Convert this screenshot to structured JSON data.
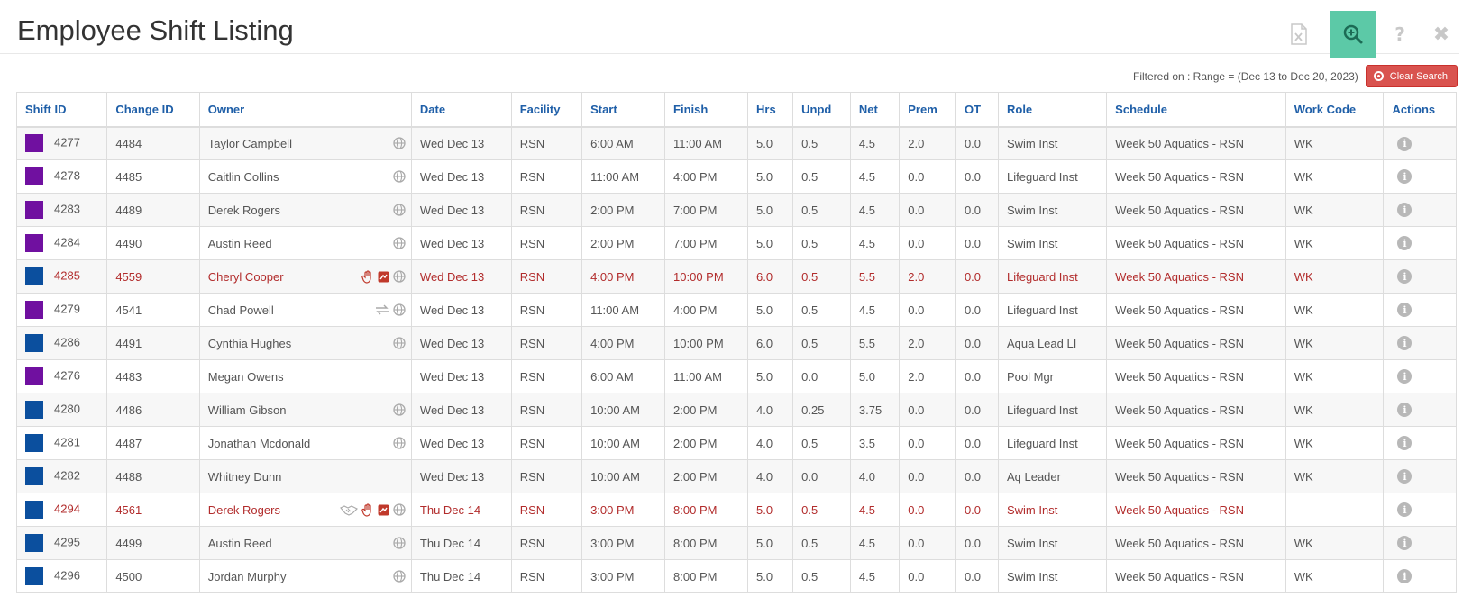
{
  "header": {
    "title": "Employee Shift Listing",
    "toolbar": [
      {
        "name": "excel-export-icon"
      },
      {
        "name": "search-zoom-icon",
        "active": true
      },
      {
        "name": "help-icon"
      },
      {
        "name": "close-icon"
      }
    ]
  },
  "filter": {
    "text": "Filtered on : Range = (Dec 13 to Dec 20, 2023)",
    "clear_label": "Clear Search"
  },
  "table": {
    "columns": [
      "Shift ID",
      "Change ID",
      "Owner",
      "Date",
      "Facility",
      "Start",
      "Finish",
      "Hrs",
      "Unpd",
      "Net",
      "Prem",
      "OT",
      "Role",
      "Schedule",
      "Work Code",
      "Actions"
    ],
    "rows": [
      {
        "color": "purple",
        "shift_id": "4277",
        "change_id": "4484",
        "owner": "Taylor Campbell",
        "icons": [
          "globe"
        ],
        "date": "Wed Dec 13",
        "facility": "RSN",
        "start": "6:00 AM",
        "finish": "11:00 AM",
        "hrs": "5.0",
        "unpd": "0.5",
        "net": "4.5",
        "prem": "2.0",
        "ot": "0.0",
        "role": "Swim Inst",
        "schedule": "Week 50 Aquatics - RSN",
        "work_code": "WK",
        "changed": false
      },
      {
        "color": "purple",
        "shift_id": "4278",
        "change_id": "4485",
        "owner": "Caitlin Collins",
        "icons": [
          "globe"
        ],
        "date": "Wed Dec 13",
        "facility": "RSN",
        "start": "11:00 AM",
        "finish": "4:00 PM",
        "hrs": "5.0",
        "unpd": "0.5",
        "net": "4.5",
        "prem": "0.0",
        "ot": "0.0",
        "role": "Lifeguard Inst",
        "schedule": "Week 50 Aquatics - RSN",
        "work_code": "WK",
        "changed": false
      },
      {
        "color": "purple",
        "shift_id": "4283",
        "change_id": "4489",
        "owner": "Derek Rogers",
        "icons": [
          "globe"
        ],
        "date": "Wed Dec 13",
        "facility": "RSN",
        "start": "2:00 PM",
        "finish": "7:00 PM",
        "hrs": "5.0",
        "unpd": "0.5",
        "net": "4.5",
        "prem": "0.0",
        "ot": "0.0",
        "role": "Swim Inst",
        "schedule": "Week 50 Aquatics - RSN",
        "work_code": "WK",
        "changed": false
      },
      {
        "color": "purple",
        "shift_id": "4284",
        "change_id": "4490",
        "owner": "Austin Reed",
        "icons": [
          "globe"
        ],
        "date": "Wed Dec 13",
        "facility": "RSN",
        "start": "2:00 PM",
        "finish": "7:00 PM",
        "hrs": "5.0",
        "unpd": "0.5",
        "net": "4.5",
        "prem": "0.0",
        "ot": "0.0",
        "role": "Swim Inst",
        "schedule": "Week 50 Aquatics - RSN",
        "work_code": "WK",
        "changed": false
      },
      {
        "color": "blue",
        "shift_id": "4285",
        "change_id": "4559",
        "owner": "Cheryl Cooper",
        "icons": [
          "hand",
          "red-square",
          "globe"
        ],
        "date": "Wed Dec 13",
        "facility": "RSN",
        "start": "4:00 PM",
        "finish": "10:00 PM",
        "hrs": "6.0",
        "unpd": "0.5",
        "net": "5.5",
        "prem": "2.0",
        "ot": "0.0",
        "role": "Lifeguard Inst",
        "schedule": "Week 50 Aquatics - RSN",
        "work_code": "WK",
        "changed": true
      },
      {
        "color": "purple",
        "shift_id": "4279",
        "change_id": "4541",
        "owner": "Chad Powell",
        "icons": [
          "swap",
          "globe"
        ],
        "date": "Wed Dec 13",
        "facility": "RSN",
        "start": "11:00 AM",
        "finish": "4:00 PM",
        "hrs": "5.0",
        "unpd": "0.5",
        "net": "4.5",
        "prem": "0.0",
        "ot": "0.0",
        "role": "Lifeguard Inst",
        "schedule": "Week 50 Aquatics - RSN",
        "work_code": "WK",
        "changed": false
      },
      {
        "color": "blue",
        "shift_id": "4286",
        "change_id": "4491",
        "owner": "Cynthia Hughes",
        "icons": [
          "globe"
        ],
        "date": "Wed Dec 13",
        "facility": "RSN",
        "start": "4:00 PM",
        "finish": "10:00 PM",
        "hrs": "6.0",
        "unpd": "0.5",
        "net": "5.5",
        "prem": "2.0",
        "ot": "0.0",
        "role": "Aqua Lead LI",
        "schedule": "Week 50 Aquatics - RSN",
        "work_code": "WK",
        "changed": false
      },
      {
        "color": "purple",
        "shift_id": "4276",
        "change_id": "4483",
        "owner": "Megan Owens",
        "icons": [],
        "date": "Wed Dec 13",
        "facility": "RSN",
        "start": "6:00 AM",
        "finish": "11:00 AM",
        "hrs": "5.0",
        "unpd": "0.0",
        "net": "5.0",
        "prem": "2.0",
        "ot": "0.0",
        "role": "Pool Mgr",
        "schedule": "Week 50 Aquatics - RSN",
        "work_code": "WK",
        "changed": false
      },
      {
        "color": "blue",
        "shift_id": "4280",
        "change_id": "4486",
        "owner": "William Gibson",
        "icons": [
          "globe"
        ],
        "date": "Wed Dec 13",
        "facility": "RSN",
        "start": "10:00 AM",
        "finish": "2:00 PM",
        "hrs": "4.0",
        "unpd": "0.25",
        "net": "3.75",
        "prem": "0.0",
        "ot": "0.0",
        "role": "Lifeguard Inst",
        "schedule": "Week 50 Aquatics - RSN",
        "work_code": "WK",
        "changed": false
      },
      {
        "color": "blue",
        "shift_id": "4281",
        "change_id": "4487",
        "owner": "Jonathan Mcdonald",
        "icons": [
          "globe"
        ],
        "date": "Wed Dec 13",
        "facility": "RSN",
        "start": "10:00 AM",
        "finish": "2:00 PM",
        "hrs": "4.0",
        "unpd": "0.5",
        "net": "3.5",
        "prem": "0.0",
        "ot": "0.0",
        "role": "Lifeguard Inst",
        "schedule": "Week 50 Aquatics - RSN",
        "work_code": "WK",
        "changed": false
      },
      {
        "color": "blue",
        "shift_id": "4282",
        "change_id": "4488",
        "owner": "Whitney Dunn",
        "icons": [],
        "date": "Wed Dec 13",
        "facility": "RSN",
        "start": "10:00 AM",
        "finish": "2:00 PM",
        "hrs": "4.0",
        "unpd": "0.0",
        "net": "4.0",
        "prem": "0.0",
        "ot": "0.0",
        "role": "Aq Leader",
        "schedule": "Week 50 Aquatics - RSN",
        "work_code": "WK",
        "changed": false
      },
      {
        "color": "blue",
        "shift_id": "4294",
        "change_id": "4561",
        "owner": "Derek Rogers",
        "icons": [
          "handshake",
          "hand",
          "red-square",
          "globe"
        ],
        "date": "Thu Dec 14",
        "facility": "RSN",
        "start": "3:00 PM",
        "finish": "8:00 PM",
        "hrs": "5.0",
        "unpd": "0.5",
        "net": "4.5",
        "prem": "0.0",
        "ot": "0.0",
        "role": "Swim Inst",
        "schedule": "Week 50 Aquatics - RSN",
        "work_code": "",
        "changed": true
      },
      {
        "color": "blue",
        "shift_id": "4295",
        "change_id": "4499",
        "owner": "Austin Reed",
        "icons": [
          "globe"
        ],
        "date": "Thu Dec 14",
        "facility": "RSN",
        "start": "3:00 PM",
        "finish": "8:00 PM",
        "hrs": "5.0",
        "unpd": "0.5",
        "net": "4.5",
        "prem": "0.0",
        "ot": "0.0",
        "role": "Swim Inst",
        "schedule": "Week 50 Aquatics - RSN",
        "work_code": "WK",
        "changed": false
      },
      {
        "color": "blue",
        "shift_id": "4296",
        "change_id": "4500",
        "owner": "Jordan Murphy",
        "icons": [
          "globe"
        ],
        "date": "Thu Dec 14",
        "facility": "RSN",
        "start": "3:00 PM",
        "finish": "8:00 PM",
        "hrs": "5.0",
        "unpd": "0.5",
        "net": "4.5",
        "prem": "0.0",
        "ot": "0.0",
        "role": "Swim Inst",
        "schedule": "Week 50 Aquatics - RSN",
        "work_code": "WK",
        "changed": false
      }
    ]
  }
}
